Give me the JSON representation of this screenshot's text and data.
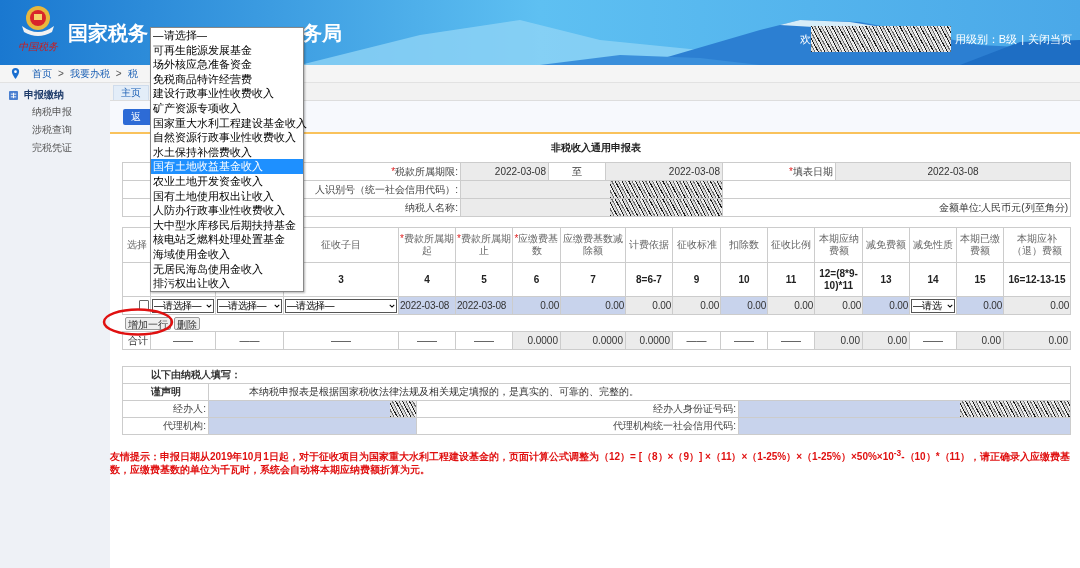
{
  "header": {
    "logo_text": "中国税务",
    "title_start": "国家税务",
    "title_end": "务局",
    "welcome": "欢",
    "user_redacted": true,
    "credit_level": "用级别：B级",
    "separator": "|",
    "close_link": "关闭当页"
  },
  "breadcrumb": {
    "items": [
      "首页",
      "我要办税",
      "税"
    ],
    "separators": [
      ">",
      ">"
    ]
  },
  "sidebar": {
    "heading": "申报缴纳",
    "items": [
      "纳税申报",
      "涉税查询",
      "完税凭证"
    ]
  },
  "tabs": [
    {
      "label": "主页",
      "selected": true
    }
  ],
  "back_button": "返",
  "form_title": "非税收入通用申报表",
  "info": {
    "period_label": {
      "mark": "*",
      "text": "税款所属期限:"
    },
    "period_start": "2022-03-08",
    "period_to": "至",
    "period_end": "2022-03-08",
    "fill_date_label": {
      "mark": "*",
      "text": "填表日期"
    },
    "fill_date": "2022-03-08",
    "taxpayer_id_label": "人识别号（统一社会信用代码）:",
    "taxpayer_id_redacted": true,
    "taxpayer_name_label": "纳税人名称:",
    "taxpayer_name_redacted": true,
    "amount_unit": "金额单位:人民币元(列至角分)"
  },
  "table": {
    "columns": [
      {
        "label": "选择"
      },
      {
        "label": "征收子目"
      },
      {
        "label": "费款所属期起",
        "mark": "*"
      },
      {
        "label": "费款所属期止",
        "mark": "*"
      },
      {
        "label": "应缴费基数",
        "mark": "*"
      },
      {
        "label": "应缴费基数减除额"
      },
      {
        "label": "计费依据"
      },
      {
        "label": "征收标准"
      },
      {
        "label": "扣除数"
      },
      {
        "label": "征收比例"
      },
      {
        "label": "本期应纳费额"
      },
      {
        "label": "减免费额"
      },
      {
        "label": "减免性质"
      },
      {
        "label": "本期已缴费额"
      },
      {
        "label": "本期应补（退）费额"
      }
    ],
    "numbers": [
      "3",
      "4",
      "5",
      "6",
      "7",
      "8=6-7",
      "9",
      "10",
      "11",
      "12=(8*9-10)*11",
      "13",
      "14",
      "15",
      "16=12-13-15"
    ],
    "row": {
      "checked": false,
      "cells": [
        {
          "kind": "select",
          "value": "—请选择—"
        },
        {
          "kind": "select",
          "value": "—请选择—"
        },
        {
          "kind": "select",
          "value": "—请选择—"
        },
        {
          "kind": "input",
          "value": "2022-03-08"
        },
        {
          "kind": "input",
          "value": "2022-03-08"
        },
        {
          "kind": "input",
          "value": "0.00"
        },
        {
          "kind": "input",
          "value": "0.00"
        },
        {
          "kind": "calc",
          "value": "0.00"
        },
        {
          "kind": "calc",
          "value": "0.00"
        },
        {
          "kind": "input",
          "value": "0.00"
        },
        {
          "kind": "calc",
          "value": "0.00"
        },
        {
          "kind": "calc",
          "value": "0.00"
        },
        {
          "kind": "input",
          "value": "0.00"
        },
        {
          "kind": "select",
          "value": "—请选"
        },
        {
          "kind": "input",
          "value": "0.00"
        },
        {
          "kind": "calc",
          "value": "0.00"
        }
      ]
    },
    "buttons": [
      "增加一行",
      "删除"
    ],
    "total": {
      "label": "合计",
      "cells": [
        {
          "kind": "plain",
          "value": "——"
        },
        {
          "kind": "plain",
          "value": "——"
        },
        {
          "kind": "plain",
          "value": "——"
        },
        {
          "kind": "plain",
          "value": "——"
        },
        {
          "kind": "plain",
          "value": "——"
        },
        {
          "kind": "calc",
          "value": "0.0000"
        },
        {
          "kind": "calc",
          "value": "0.0000"
        },
        {
          "kind": "calc",
          "value": "0.0000"
        },
        {
          "kind": "plain",
          "value": "——"
        },
        {
          "kind": "plain",
          "value": "——"
        },
        {
          "kind": "plain",
          "value": "——"
        },
        {
          "kind": "calc",
          "value": "0.00"
        },
        {
          "kind": "calc",
          "value": "0.00"
        },
        {
          "kind": "plain",
          "value": "——"
        },
        {
          "kind": "calc",
          "value": "0.00"
        },
        {
          "kind": "calc",
          "value": "0.00"
        }
      ]
    }
  },
  "declaration": {
    "heading": "以下由纳税人填写：",
    "statement_label": "谨声明",
    "statement": "本纳税申报表是根据国家税收法律法规及相关规定填报的，是真实的、可靠的、完整的。",
    "fields": [
      {
        "label": "经办人:",
        "redacted": true
      },
      {
        "label": "经办人身份证号码:",
        "redacted": true
      },
      {
        "label": "代理机构:",
        "redacted": false
      },
      {
        "label": "代理机构统一社会信用代码:",
        "redacted": false
      }
    ]
  },
  "tip": "友情提示：申报日期从2019年10月1日起，对于征收项目为国家重大水利工程建设基金的，页面计算公式调整为（12）= [（8）×（9）] ×（11）×（1-25%）×（1-25%）×50%×10$^{-3}$-（10）*（11），请正确录入应缴费基数，应缴费基数的单位为千瓦时，系统会自动将本期应纳费额折算为元。",
  "dropdown": {
    "options": [
      {
        "label": "—请选择—",
        "selected": false
      },
      {
        "label": "可再生能源发展基金",
        "selected": false
      },
      {
        "label": "场外核应急准备资金",
        "selected": false
      },
      {
        "label": "免税商品特许经营费",
        "selected": false
      },
      {
        "label": "建设行政事业性收费收入",
        "selected": false
      },
      {
        "label": "矿产资源专项收入",
        "selected": false
      },
      {
        "label": "国家重大水利工程建设基金收入",
        "selected": false
      },
      {
        "label": "自然资源行政事业性收费收入",
        "selected": false
      },
      {
        "label": "水土保持补偿费收入",
        "selected": false
      },
      {
        "label": "国有土地收益基金收入",
        "selected": true
      },
      {
        "label": "农业土地开发资金收入",
        "selected": false
      },
      {
        "label": "国有土地使用权出让收入",
        "selected": false
      },
      {
        "label": "人防办行政事业性收费收入",
        "selected": false
      },
      {
        "label": "大中型水库移民后期扶持基金",
        "selected": false
      },
      {
        "label": "核电站乏燃料处理处置基金",
        "selected": false
      },
      {
        "label": "海域使用金收入",
        "selected": false
      },
      {
        "label": "无居民海岛使用金收入",
        "selected": false
      },
      {
        "label": "排污权出让收入",
        "selected": false
      }
    ]
  }
}
